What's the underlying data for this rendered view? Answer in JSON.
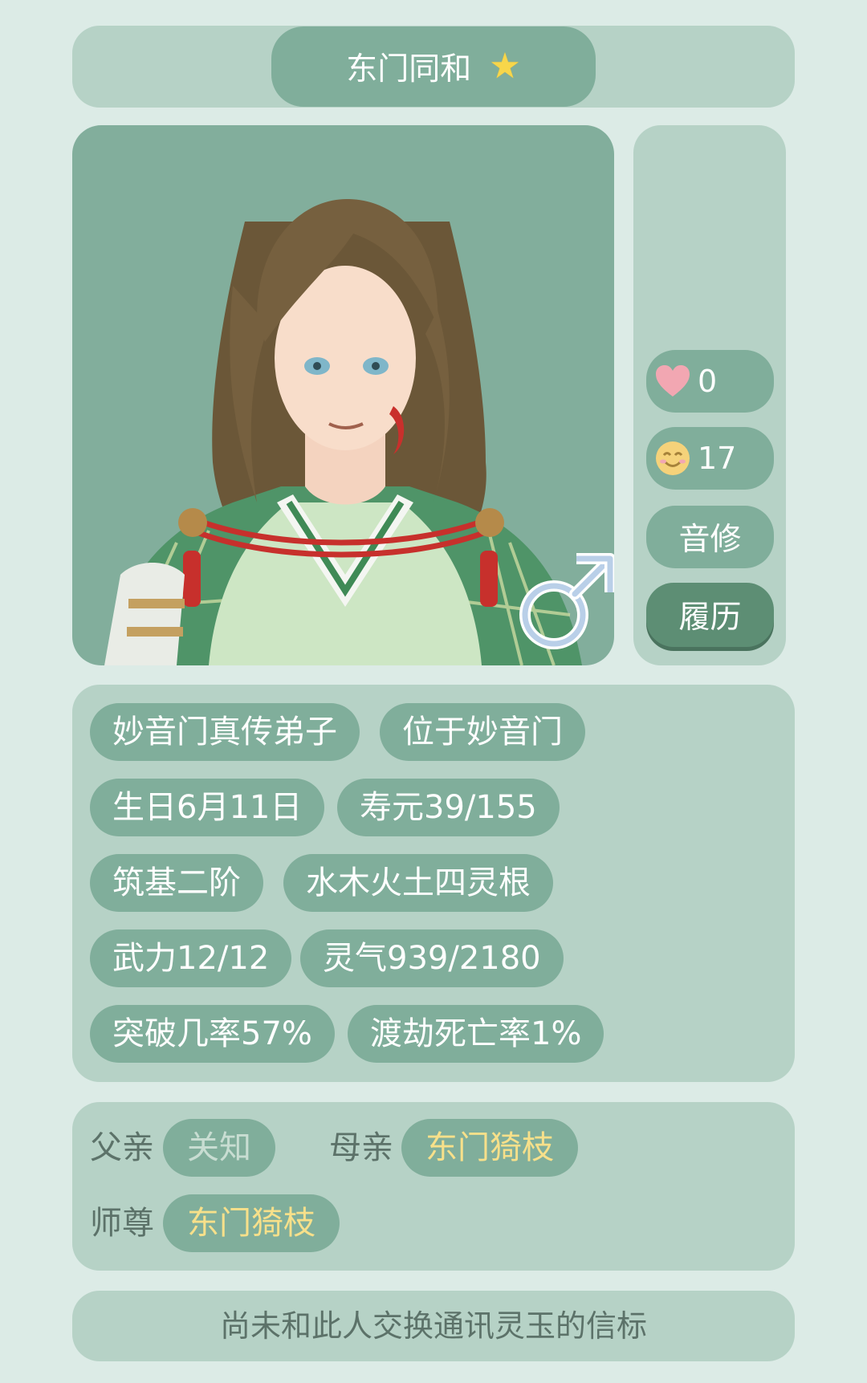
{
  "header": {
    "name": "东门同和",
    "star_icon": "star-icon"
  },
  "portrait": {
    "gender_icon": "male-symbol-icon"
  },
  "side": {
    "affection": "0",
    "mood": "17",
    "cultivation_path": "音修",
    "resume_button": "履历"
  },
  "attributes": [
    [
      "妙音门真传弟子",
      "位于妙音门"
    ],
    [
      "生日6月11日",
      "寿元39/155"
    ],
    [
      "筑基二阶",
      "水木火土四灵根"
    ],
    [
      "武力12/12",
      "灵气939/2180"
    ],
    [
      "突破几率57%",
      "渡劫死亡率1%"
    ]
  ],
  "family": {
    "father_label": "父亲",
    "father_value": "关知",
    "mother_label": "母亲",
    "mother_value": "东门猗枝",
    "master_label": "师尊",
    "master_value": "东门猗枝"
  },
  "footer": {
    "message": "尚未和此人交换通讯灵玉的信标"
  },
  "colors": {
    "background": "#dcebe6",
    "panel": "#b6d2c6",
    "pill": "#80ae9b",
    "button_dark": "#5d8e74",
    "accent_gold": "#f7e08a",
    "heart": "#f2a7b2",
    "emoji": "#f5d27a"
  }
}
